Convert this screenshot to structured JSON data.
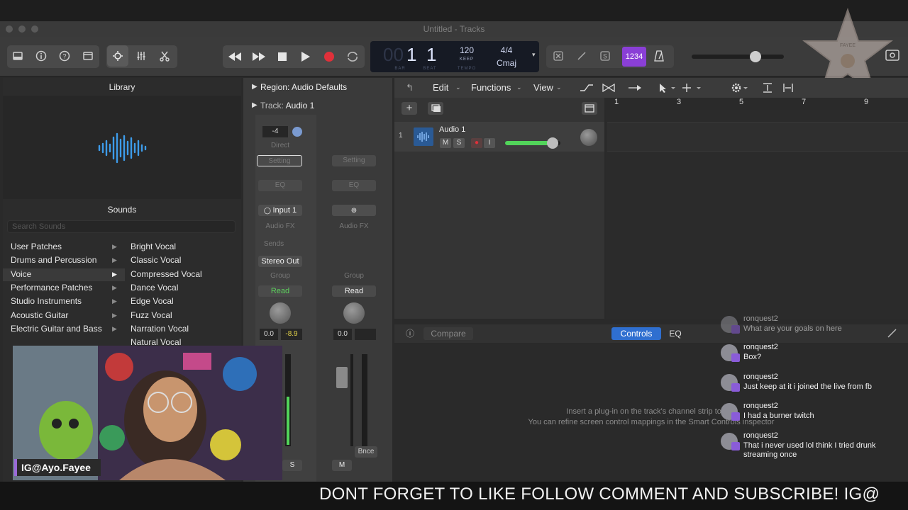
{
  "window": {
    "title": "Untitled - Tracks"
  },
  "lcd": {
    "bar": "1",
    "beat": "1",
    "tempo": "120",
    "tempo_label": "KEEP",
    "signature": "4/4",
    "key": "Cmaj",
    "bar_ghost": "00",
    "bar_label": "BAR",
    "beat_label": "BEAT",
    "tempo_sub": "TEMPO"
  },
  "toolbar": {
    "count_in": "1234"
  },
  "library": {
    "title": "Library",
    "sounds_title": "Sounds",
    "search_placeholder": "Search Sounds",
    "categories": [
      "User Patches",
      "Drums and Percussion",
      "Voice",
      "Performance Patches",
      "Studio Instruments",
      "Acoustic Guitar",
      "Electric Guitar and Bass"
    ],
    "patches": [
      "Bright Vocal",
      "Classic Vocal",
      "Compressed Vocal",
      "Dance Vocal",
      "Edge Vocal",
      "Fuzz Vocal",
      "Narration Vocal",
      "Natural Vocal"
    ]
  },
  "inspector": {
    "region_label": "Region:",
    "region_value": "Audio Defaults",
    "track_label": "Track:",
    "track_value": "Audio 1",
    "strip1": {
      "gain": "-4",
      "direct": "Direct",
      "setting": "Setting",
      "eq": "EQ",
      "input": "Input 1",
      "audio_fx": "Audio FX",
      "sends": "Sends",
      "output": "Stereo Out",
      "group": "Group",
      "automation": "Read",
      "vol": "0.0",
      "peak": "-8.9",
      "solo": "S"
    },
    "strip2": {
      "setting": "Setting",
      "eq": "EQ",
      "audio_fx": "Audio FX",
      "group": "Group",
      "automation": "Read",
      "vol": "0.0",
      "bounce": "Bnce",
      "mute": "M"
    }
  },
  "tracks": {
    "menus": [
      "Edit",
      "Functions",
      "View"
    ],
    "ruler": [
      "1",
      "3",
      "5",
      "7",
      "9"
    ],
    "track": {
      "number": "1",
      "name": "Audio 1",
      "mute": "M",
      "solo": "S",
      "input": "I"
    }
  },
  "smart_controls": {
    "compare": "Compare",
    "controls_tab": "Controls",
    "eq_tab": "EQ",
    "message_line1": "Insert a plug-in on the track's channel strip to use",
    "message_line2": "You can refine screen control mappings in the Smart Controls inspector"
  },
  "webcam": {
    "tag": "IG@Ayo.Fayee"
  },
  "overlay": {
    "star_label": "FAYEE"
  },
  "chat": [
    {
      "user": "ronquest2",
      "message": "What are your goals on here"
    },
    {
      "user": "ronquest2",
      "message": "Box?"
    },
    {
      "user": "ronquest2",
      "message": "Just keep at it i joined the live from fb"
    },
    {
      "user": "ronquest2",
      "message": "I had a burner twitch"
    },
    {
      "user": "ronquest2",
      "message": "That i never used lol think I tried drunk streaming once"
    }
  ],
  "banner": {
    "text": "DONT FORGET TO LIKE FOLLOW COMMENT AND SUBSCRIBE! IG@"
  },
  "colors": {
    "accent": "#2f6fd0",
    "record": "#e0303a",
    "purple": "#8a3fd6",
    "meter_green": "#52d45a"
  }
}
